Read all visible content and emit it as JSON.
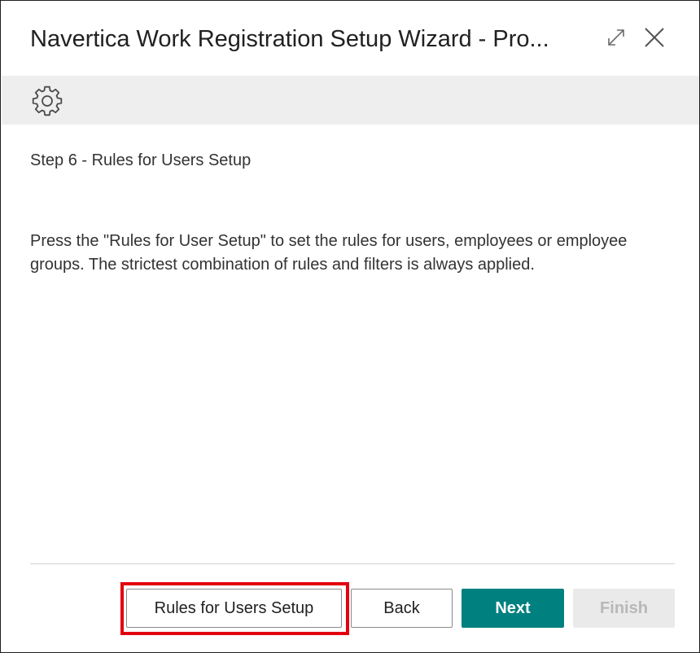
{
  "dialog": {
    "title": "Navertica Work Registration Setup Wizard - Pro...",
    "expand_icon": "expand-diagonal-arrows-icon",
    "close_icon": "close-x-icon"
  },
  "actionbar": {
    "settings_icon": "gear-icon"
  },
  "content": {
    "step_title": "Step 6 - Rules for Users Setup",
    "instructions": "Press the \"Rules for User Setup\" to set the rules for users, employees or employee groups. The strictest combination of rules and filters is always applied."
  },
  "footer": {
    "rules_button_label": "Rules for Users Setup",
    "back_button_label": "Back",
    "next_button_label": "Next",
    "finish_button_label": "Finish",
    "finish_disabled": true
  },
  "colors": {
    "primary_button": "#00807f",
    "highlight_border": "#e3000f",
    "actionbar_bg": "#eeeeee"
  }
}
